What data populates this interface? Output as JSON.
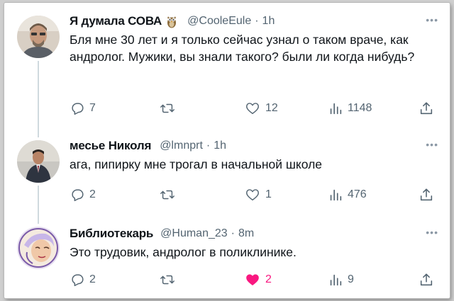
{
  "tweets": [
    {
      "name": "Я думала СОВА",
      "handle": "@CooleEule",
      "time": "1h",
      "text": "Бля мне 30 лет и я только сейчас узнал о таком враче, как андролог. Мужики, вы знали такого? были ли когда нибудь?",
      "replies": "7",
      "retweets": "",
      "likes": "12",
      "views": "1148",
      "liked": false
    },
    {
      "name": "месье Николя",
      "handle": "@lmnprt",
      "time": "1h",
      "text": "ага, пипирку мне трогал в начальной школе",
      "replies": "2",
      "retweets": "",
      "likes": "1",
      "views": "476",
      "liked": false
    },
    {
      "name": "Библиотекарь",
      "handle": "@Human_23",
      "time": "8m",
      "text": "Это трудовик, андролог в поликлинике.",
      "replies": "2",
      "retweets": "",
      "likes": "2",
      "views": "9",
      "liked": true
    }
  ],
  "colors": {
    "text": "#0f1419",
    "muted": "#536471",
    "like": "#f91880",
    "line": "#cfd9de"
  },
  "icons": [
    "reply-icon",
    "retweet-icon",
    "heart-icon",
    "views-icon",
    "share-icon",
    "more-icon",
    "owl-emoji-icon"
  ]
}
